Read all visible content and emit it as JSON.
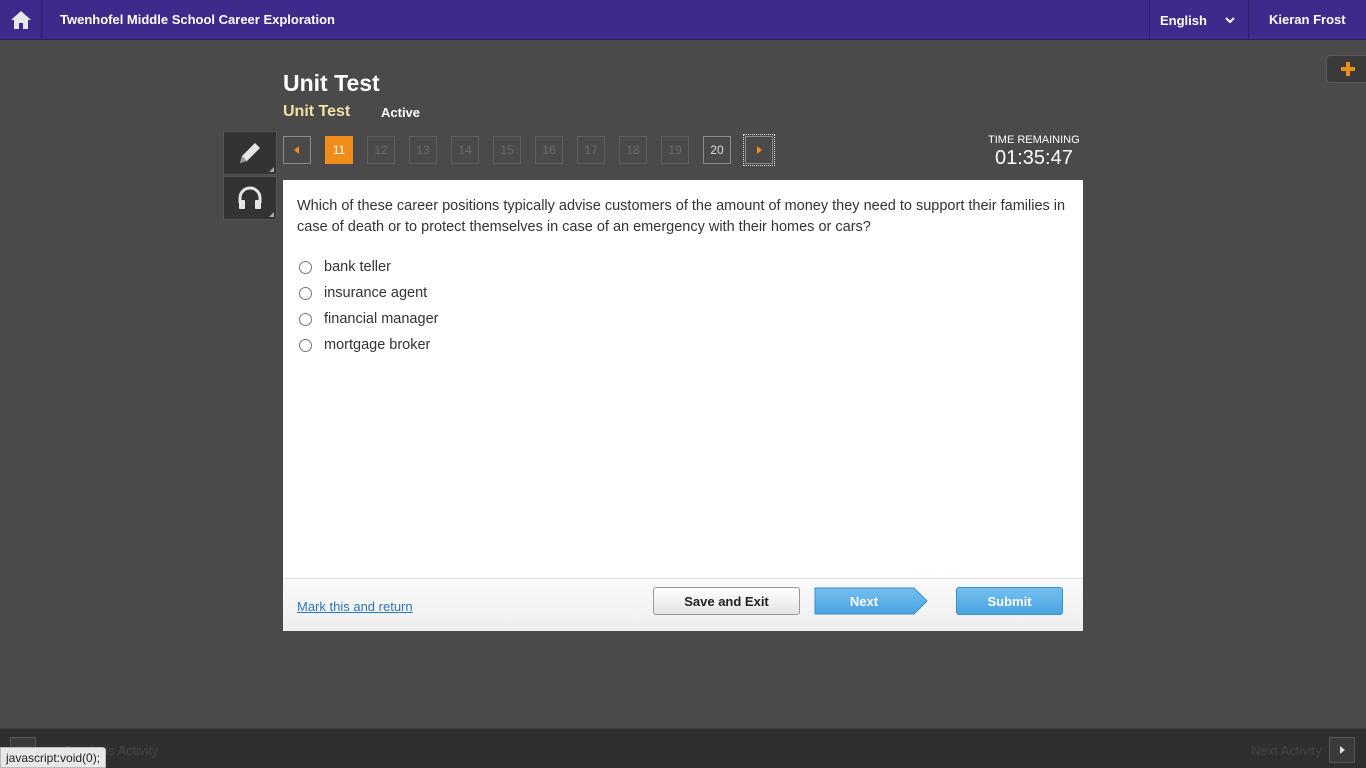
{
  "header": {
    "title": "Twenhofel Middle School Career Exploration",
    "language": "English",
    "user": "Kieran Frost"
  },
  "test": {
    "title": "Unit Test",
    "subtitle": "Unit Test",
    "status": "Active"
  },
  "nav": {
    "questions": [
      "11",
      "12",
      "13",
      "14",
      "15",
      "16",
      "17",
      "18",
      "19",
      "20"
    ],
    "current": "11"
  },
  "timer": {
    "label": "TIME REMAINING",
    "value": "01:35:47"
  },
  "question": {
    "text": "Which of these career positions typically advise customers of the amount of money they need to support their families in case of death or to protect themselves in case of an emergency with their homes or cars?",
    "choices": [
      "bank teller",
      "insurance agent",
      "financial manager",
      "mortgage broker"
    ]
  },
  "footer": {
    "mark_label": "Mark this and return",
    "save_label": "Save and Exit",
    "next_label": "Next",
    "submit_label": "Submit"
  },
  "bottom": {
    "prev_label": "Previous Activity",
    "next_label": "Next Activity"
  },
  "status_tip": "javascript:void(0);",
  "colors": {
    "topbar": "#3d2a8a",
    "accent": "#f08c1a",
    "button_blue": "#4aa3e0"
  }
}
